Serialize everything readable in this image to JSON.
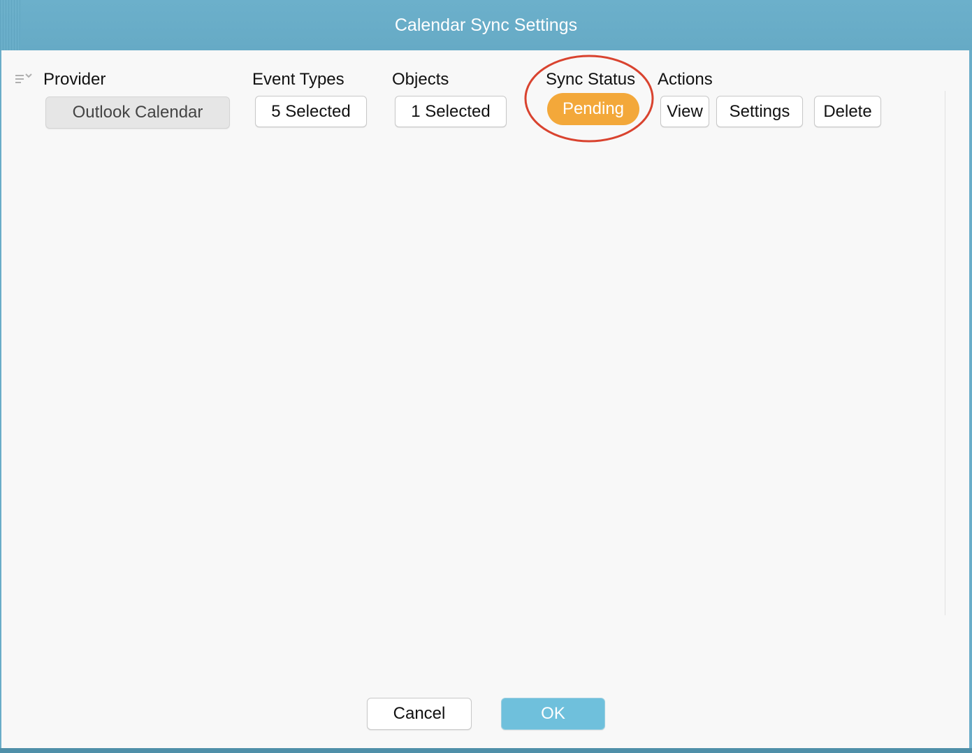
{
  "window": {
    "title": "Calendar Sync Settings"
  },
  "table": {
    "headers": {
      "provider": "Provider",
      "event_types": "Event Types",
      "objects": "Objects",
      "sync_status": "Sync Status",
      "actions": "Actions"
    },
    "row": {
      "provider": "Outlook Calendar",
      "event_types": "5 Selected",
      "objects": "1 Selected",
      "sync_status": "Pending",
      "actions": {
        "view": "View",
        "settings": "Settings",
        "delete": "Delete"
      }
    },
    "menu_icon": "column-menu-icon"
  },
  "footer": {
    "cancel": "Cancel",
    "ok": "OK"
  },
  "colors": {
    "titlebar": "#6aadc8",
    "pending": "#f3a83a",
    "ok_button": "#6fc0dc",
    "highlight": "#d9432f"
  }
}
